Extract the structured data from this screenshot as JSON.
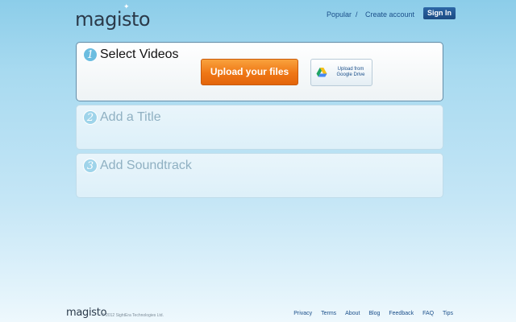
{
  "header": {
    "logo": "magisto",
    "nav": {
      "popular": "Popular",
      "separator": "/",
      "create_account": "Create account"
    },
    "sign_in": "Sign In"
  },
  "steps": [
    {
      "number": "1",
      "title": "Select Videos",
      "active": true
    },
    {
      "number": "2",
      "title": "Add a Title",
      "active": false
    },
    {
      "number": "3",
      "title": "Add Soundtrack",
      "active": false
    }
  ],
  "upload": {
    "upload_files_label": "Upload your files",
    "gdrive_line1": "Upload from",
    "gdrive_line2": "Google Drive",
    "gdrive_icon": "google-drive-icon"
  },
  "footer": {
    "logo": "magisto",
    "copyright": "© 2012 SightEra Technologies Ltd.",
    "links": [
      "Privacy",
      "Terms",
      "About",
      "Blog",
      "Feedback",
      "FAQ",
      "Tips"
    ]
  },
  "colors": {
    "accent_orange": "#ef7715",
    "link_blue": "#1b4f8a",
    "sign_in_bg": "#1b4a82"
  }
}
